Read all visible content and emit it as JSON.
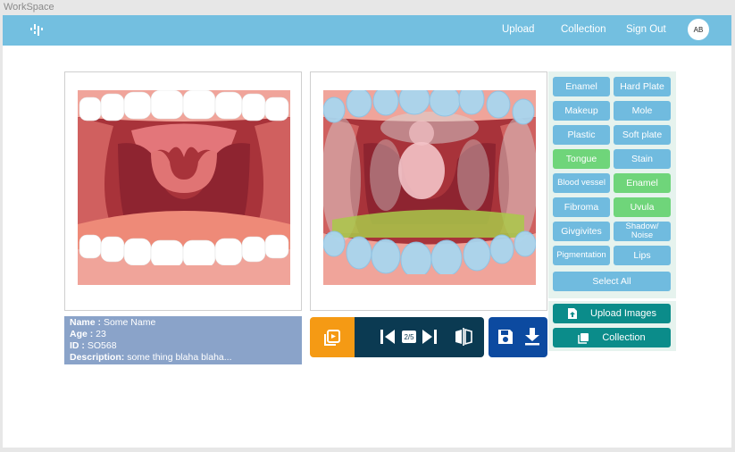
{
  "window": {
    "title": "WorkSpace"
  },
  "header": {
    "logo": "workspace-logo-icon",
    "nav": [
      "Upload",
      "Collection",
      "Sign Out"
    ],
    "avatar": "AB"
  },
  "patient": {
    "name_label": "Name :",
    "name": "Some Name",
    "age_label": "Age :",
    "age": "23",
    "id_label": "ID :",
    "id": "SO568",
    "description_label": "Description:",
    "description": "some thing blaha blaha..."
  },
  "viewer": {
    "page_indicator": "2/5"
  },
  "labels": [
    {
      "text": "Enamel",
      "selected": false
    },
    {
      "text": "Hard Plate",
      "selected": false
    },
    {
      "text": "Makeup",
      "selected": false
    },
    {
      "text": "Mole",
      "selected": false
    },
    {
      "text": "Plastic",
      "selected": false
    },
    {
      "text": "Soft plate",
      "selected": false
    },
    {
      "text": "Tongue",
      "selected": true
    },
    {
      "text": "Stain",
      "selected": false
    },
    {
      "text": "Blood vessel",
      "selected": false
    },
    {
      "text": "Enamel",
      "selected": true
    },
    {
      "text": "Fibroma",
      "selected": false
    },
    {
      "text": "Uvula",
      "selected": true
    },
    {
      "text": "Givgivites",
      "selected": false
    },
    {
      "text": "Shadow/ Noise",
      "selected": false
    },
    {
      "text": "Pigmentation",
      "selected": false
    },
    {
      "text": "Lips",
      "selected": false
    }
  ],
  "select_all": "Select All",
  "actions": {
    "upload": "Upload Images",
    "collection": "Collection"
  },
  "colors": {
    "header": "#73bfe0",
    "label_default": "#70bbdf",
    "label_selected": "#6fd57a",
    "action": "#0b8c8a",
    "info": "#8aa3c9",
    "orange": "#f59a14",
    "dark": "#0b3a52",
    "save_blue": "#0c4aa0"
  }
}
